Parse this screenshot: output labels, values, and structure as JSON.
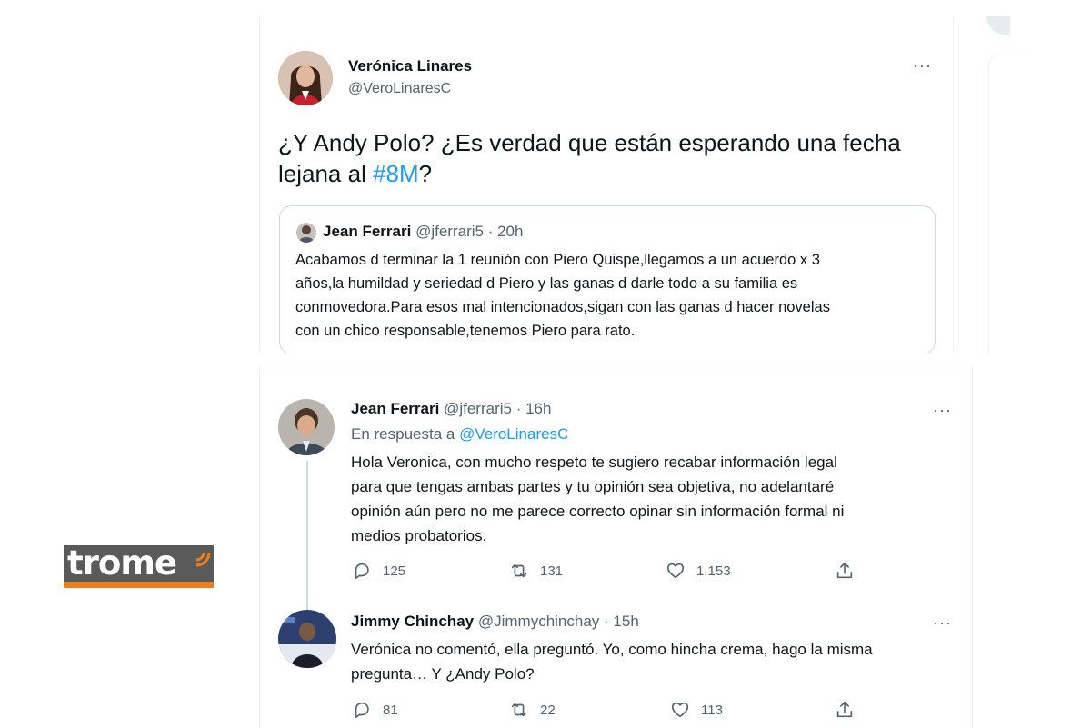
{
  "main_tweet": {
    "author_name": "Verónica Linares",
    "author_handle": "@VeroLinaresC",
    "text_before": "¿Y Andy Polo? ¿Es verdad que están esperando una fecha lejana al ",
    "hashtag": "#8M",
    "text_after": "?",
    "more_label": "···"
  },
  "quoted_tweet": {
    "author_name": "Jean Ferrari",
    "author_handle": "@jferrari5",
    "time": "· 20h",
    "lines": [
      "Acabamos d terminar la 1 reunión con Piero Quispe,llegamos a un acuerdo x 3",
      "años,la humildad y seriedad d Piero y las ganas d darle todo a su familia es",
      "conmovedora.Para esos mal intencionados,sigan con las ganas d hacer novelas",
      "con un chico responsable,tenemos Piero para rato."
    ]
  },
  "replies": [
    {
      "author_name": "Jean Ferrari",
      "author_handle": "@jferrari5",
      "time": "· 16h",
      "reply_to_prefix": "En respuesta a ",
      "reply_to_handle": "@VeroLinaresC",
      "lines": [
        "Hola Veronica, con mucho respeto te sugiero recabar información legal",
        "para que tengas ambas partes y tu opinión sea objetiva, no adelantaré",
        "opinión aún pero no me parece correcto opinar sin información formal ni",
        "medios probatorios."
      ],
      "replies_count": "125",
      "retweets_count": "131",
      "likes_count": "1.153",
      "more_label": "···"
    },
    {
      "author_name": "Jimmy Chinchay",
      "author_handle": "@Jimmychinchay",
      "time": "· 15h",
      "lines": [
        "Verónica no comentó, ella preguntó. Yo, como hincha crema, hago la misma",
        "pregunta… Y ¿Andy Polo?"
      ],
      "replies_count": "81",
      "retweets_count": "22",
      "likes_count": "113",
      "more_label": "···"
    }
  ],
  "logo": {
    "text": "trome"
  },
  "colors": {
    "accent": "#1d9bf0",
    "muted": "#536471",
    "logo_orange": "#f07d1a",
    "logo_grey": "#5a5a5a"
  }
}
